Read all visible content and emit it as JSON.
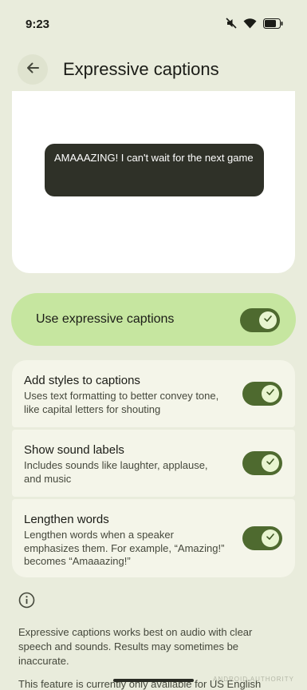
{
  "status_bar": {
    "time": "9:23",
    "icons": [
      "mute-icon",
      "wifi-icon",
      "battery-icon"
    ]
  },
  "app_bar": {
    "back_icon": "arrow-back-icon",
    "title": "Expressive captions"
  },
  "preview": {
    "caption_text": "AMAAAZING! I can't wait for the next game"
  },
  "main_toggle": {
    "label": "Use expressive captions",
    "checked": true
  },
  "settings": [
    {
      "title": "Add styles to captions",
      "description": "Uses text formatting to better convey tone, like capital letters for shouting",
      "checked": true
    },
    {
      "title": "Show sound labels",
      "description": "Includes sounds like laughter, applause, and music",
      "checked": true
    },
    {
      "title": "Lengthen words",
      "description": "Lengthen words when a speaker emphasizes them. For example, “Amazing!” becomes “Amaaazing!”",
      "checked": true
    }
  ],
  "info": {
    "icon": "info-icon",
    "text": "Expressive captions works best on audio with clear speech and sounds. Results may sometimes be inaccurate.",
    "text_2": "This feature is currently only available for US English"
  },
  "watermark": "ANDROID AUTHORITY",
  "colors": {
    "background": "#e9ecdc",
    "accent_container": "#c6e6a0",
    "toggle_track": "#4e6a2f",
    "caption_bubble": "#2f3128"
  }
}
